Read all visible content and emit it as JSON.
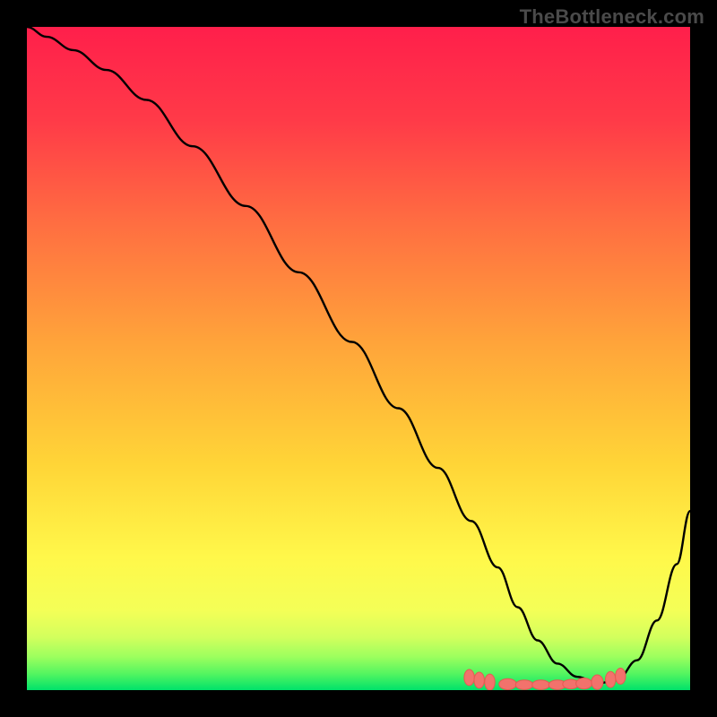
{
  "watermark": "TheBottleneck.com",
  "chart_data": {
    "type": "line",
    "title": "",
    "xlabel": "",
    "ylabel": "",
    "xlim": [
      0,
      100
    ],
    "ylim": [
      0,
      100
    ],
    "grid": false,
    "legend": false,
    "background_gradient": {
      "top_color": "#ff1f4b",
      "mid_color": "#ffd537",
      "bottom_color": "#00e26a"
    },
    "series": [
      {
        "name": "curve",
        "stroke": "#000000",
        "stroke_width": 2,
        "x": [
          0,
          3,
          7,
          12,
          18,
          25,
          33,
          41,
          49,
          56,
          62,
          67,
          71,
          74,
          77,
          80,
          83,
          86,
          89,
          92,
          95,
          98,
          100
        ],
        "y": [
          100,
          98.5,
          96.5,
          93.5,
          89,
          82,
          73,
          63,
          52.5,
          42.5,
          33.5,
          25.5,
          18.5,
          12.5,
          7.5,
          4,
          2,
          1,
          1.5,
          4.5,
          10.5,
          19,
          27
        ]
      }
    ],
    "markers": {
      "name": "optimal-zone",
      "fill": "#f2726c",
      "stroke": "#e65a52",
      "x": [
        66.7,
        68.2,
        69.8,
        72.5,
        75,
        77.5,
        80,
        82,
        84,
        86,
        88,
        89.5
      ],
      "y": [
        1.9,
        1.5,
        1.2,
        0.9,
        0.8,
        0.8,
        0.8,
        0.9,
        1.0,
        1.2,
        1.6,
        2.1
      ],
      "rx": [
        1.4,
        1.4,
        1.4,
        2.4,
        2.4,
        2.4,
        2.4,
        2.2,
        2.2,
        1.6,
        1.4,
        1.4
      ],
      "ry": [
        2.2,
        2.2,
        2.2,
        1.5,
        1.3,
        1.3,
        1.3,
        1.3,
        1.5,
        2.0,
        2.2,
        2.2
      ]
    }
  }
}
